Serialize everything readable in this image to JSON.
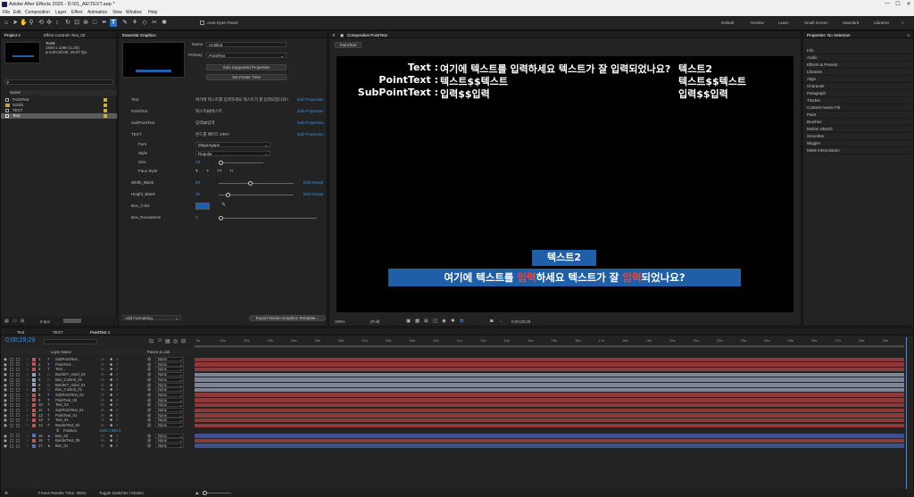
{
  "app": {
    "title": "Adobe After Effects 2025 - D:\\01_AE\\TEXT.aep *",
    "menu": [
      "File",
      "Edit",
      "Composition",
      "Layer",
      "Effect",
      "Animation",
      "View",
      "Window",
      "Help"
    ],
    "window_controls": [
      "—",
      "☐",
      "✕"
    ]
  },
  "toolbar": {
    "auto_open_label": "Auto-Open Panel",
    "workspaces": [
      "Default",
      "Review",
      "Learn",
      "Small Screen",
      "Standard",
      "Libraries"
    ]
  },
  "project": {
    "tabs": [
      "Project ≡",
      "Effect Controls Text_03"
    ],
    "thumb_name": "Text▾",
    "thumb_info1": "1920 x 1080 (1.00)",
    "thumb_info2": "Δ 0;00;30;00, 29.97 fps",
    "search_placeholder": "",
    "col_name": "Name",
    "items": [
      {
        "name": "PointText",
        "color": "#c9b037",
        "type": "comp"
      },
      {
        "name": "Solids",
        "color": "#c9b037",
        "type": "folder"
      },
      {
        "name": "TEST",
        "color": "#c9b037",
        "type": "comp"
      },
      {
        "name": "Text",
        "color": "#c9b037",
        "type": "comp",
        "selected": true
      }
    ],
    "bpc": "8 bpc"
  },
  "essential": {
    "tab": "Essential Graphics",
    "name_label": "Name",
    "name_value": "Untitled",
    "primary_label": "Primary",
    "primary_value": "PointText",
    "btn_solo": "Solo Supported Properties",
    "btn_poster": "Set Poster Time",
    "props": [
      {
        "label": "Text",
        "value": "여기에 텍스트를 입력하세요 텍스트가 잘 입력되었나요?",
        "link": "Edit Properties"
      },
      {
        "label": "PointText",
        "value": "텍스트$$텍스트",
        "link": "Edit Properties"
      },
      {
        "label": "SubPointText",
        "value": "입력$$입력",
        "link": "Edit Properties"
      },
      {
        "label": "TEXT",
        "value": "본드를 베이드 DRIY",
        "link": "Edit Properties"
      }
    ],
    "font_label": "Font",
    "font_value": "MaguAgape",
    "style_label": "Style",
    "style_value": "Regular",
    "size_label": "Size",
    "size_value": "28",
    "faux_label": "Faux Style",
    "faux_btns": [
      "T",
      "T",
      "TT",
      "Tт"
    ],
    "width_label": "Width_Blank",
    "width_value": "80",
    "height_label": "Height_Blank",
    "height_value": "20",
    "color_label": "Box_Color",
    "color_value": "#1f5fa8",
    "round_label": "Box_Roundness",
    "round_value": "0",
    "edit_range": "Edit Range",
    "add_formatting": "Add Formatting",
    "export_btn": "Export Motion Graphics Template..."
  },
  "comp": {
    "tab": "Composition PointText",
    "subtab": "PointText",
    "lines": [
      {
        "label": "Text :",
        "value": "여기에 텍스트를 입력하세요 텍스트가 잘 입력되었나요?",
        "right": "텍스트2"
      },
      {
        "label": "PointText :",
        "value": "텍스트$$텍스트",
        "right": "텍스트$$텍스트"
      },
      {
        "label": "SubPointText :",
        "value": "입력$$입력",
        "right": "입력$$입력"
      }
    ],
    "badge_small": "텍스트2",
    "banner_parts": [
      {
        "t": "여기에 텍스트를 ",
        "red": false
      },
      {
        "t": "입력",
        "red": true
      },
      {
        "t": "하세요 텍스트가 잘 ",
        "red": false
      },
      {
        "t": "입력",
        "red": true
      },
      {
        "t": "되었나요?",
        "red": false
      }
    ],
    "zoom": "100%",
    "resolution": "(Full)",
    "timecode": "0;00;29;29",
    "accent": "#1f5fa8",
    "red": "#e8483a"
  },
  "properties": {
    "title": "Properties: No Selection",
    "items": [
      "Info",
      "Audio",
      "Effects & Presets",
      "Libraries",
      "Align",
      "Character",
      "Paragraph",
      "Tracker",
      "Content-Aware Fill",
      "Paint",
      "Brushes",
      "Motion Sketch",
      "Smoother",
      "Wiggler",
      "Mask Interpolation"
    ]
  },
  "timeline": {
    "tabs": [
      "Text",
      "TEST",
      "PointText ≡"
    ],
    "timecode": "0;00;29;29",
    "search_placeholder": "",
    "col_layer": "Layer Name",
    "col_parent": "Parent & Link",
    "ruler": [
      "0s",
      "01s",
      "02s",
      "03s",
      "04s",
      "05s",
      "06s",
      "07s",
      "08s",
      "09s",
      "10s",
      "11s",
      "12s",
      "13s",
      "14s",
      "15s",
      "16s",
      "17s",
      "18s",
      "19s",
      "20s",
      "21s",
      "22s",
      "23s",
      "24s",
      "25s",
      "26s",
      "27s",
      "28s",
      "29s"
    ],
    "layers": [
      {
        "n": "1",
        "name": "SubPointText...",
        "type": "T",
        "color": "#b45a5a",
        "parent": "None",
        "bar": "#8b3a3a"
      },
      {
        "n": "2",
        "name": "PointText...",
        "type": "T",
        "color": "#b45a5a",
        "parent": "None",
        "bar": "#8b3a3a"
      },
      {
        "n": "3",
        "name": "Text...",
        "type": "T",
        "color": "#b45a5a",
        "parent": "None",
        "bar": "#8b3a3a"
      },
      {
        "n": "4",
        "name": "BorderT_mind_02",
        "type": "□",
        "color": "#9aa3b5",
        "parent": "None",
        "bar": "#7c8496"
      },
      {
        "n": "5",
        "name": "Box_Control_02",
        "type": "□",
        "color": "#9aa3b5",
        "parent": "None",
        "bar": "#7c8496"
      },
      {
        "n": "6",
        "name": "BorderT_mind_01",
        "type": "□",
        "color": "#9aa3b5",
        "parent": "None",
        "bar": "#7c8496"
      },
      {
        "n": "7",
        "name": "Box_Control_01",
        "type": "□",
        "color": "#9aa3b5",
        "parent": "None",
        "bar": "#7c8496"
      },
      {
        "n": "8",
        "name": "SubPointText_03",
        "type": "T",
        "color": "#b45a5a",
        "parent": "None",
        "bar": "#8b3a3a"
      },
      {
        "n": "9",
        "name": "PointText_03",
        "type": "T",
        "color": "#b45a5a",
        "parent": "None",
        "bar": "#8b3a3a"
      },
      {
        "n": "10",
        "name": "Text_03",
        "type": "T",
        "color": "#b45a5a",
        "parent": "None",
        "bar": "#8b3a3a"
      },
      {
        "n": "11",
        "name": "SubPointText_01",
        "type": "T",
        "color": "#b45a5a",
        "parent": "None",
        "bar": "#8b3a3a"
      },
      {
        "n": "12",
        "name": "PointText_01",
        "type": "T",
        "color": "#b45a5a",
        "parent": "None",
        "bar": "#8b3a3a"
      },
      {
        "n": "13",
        "name": "Text_01",
        "type": "T",
        "color": "#b45a5a",
        "parent": "None",
        "bar": "#8b3a3a"
      },
      {
        "n": "14",
        "name": "BorderText_02",
        "type": "T",
        "color": "#b45a5a",
        "parent": "None",
        "bar": "#8b3a3a"
      },
      {
        "n": "",
        "name": "Position",
        "type": "",
        "color": "",
        "parent": "1920.0,960.0",
        "bar": "",
        "sub": true
      },
      {
        "n": "15",
        "name": "Box_02",
        "type": "★",
        "color": "#5b6fb5",
        "parent": "None",
        "bar": "#3f4f8f"
      },
      {
        "n": "16",
        "name": "BorderText_05",
        "type": "T",
        "color": "#b45a5a",
        "parent": "None",
        "bar": "#8b3a3a"
      },
      {
        "n": "17",
        "name": "Box_01",
        "type": "★",
        "color": "#5b6fb5",
        "parent": "None",
        "bar": "#3f4f8f"
      }
    ],
    "footer_render": "Frame Render Time: 38ms",
    "footer_toggle": "Toggle Switches / Modes"
  }
}
